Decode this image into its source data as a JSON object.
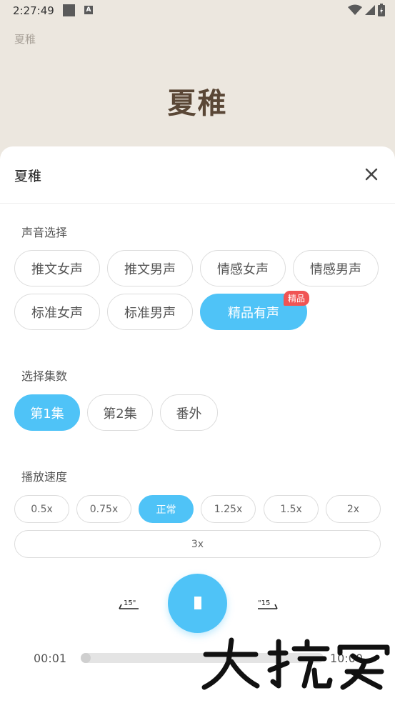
{
  "status_bar": {
    "time": "2:27:49"
  },
  "background": {
    "small_title": "夏稚",
    "big_title": "夏稚"
  },
  "sheet": {
    "title": "夏稚",
    "voice_section": {
      "label": "声音选择",
      "options": [
        "推文女声",
        "推文男声",
        "情感女声",
        "情感男声",
        "标准女声",
        "标准男声",
        "精品有声"
      ],
      "selected": "精品有声",
      "badge": "精品"
    },
    "episode_section": {
      "label": "选择集数",
      "options": [
        "第1集",
        "第2集",
        "番外"
      ],
      "selected": "第1集"
    },
    "speed_section": {
      "label": "播放速度",
      "options": [
        "0.5x",
        "0.75x",
        "正常",
        "1.25x",
        "1.5x",
        "2x",
        "3x"
      ],
      "selected": "正常"
    },
    "player": {
      "rewind_label": "15\"",
      "forward_label": "\"15",
      "current_time": "00:01",
      "total_time": "10:00",
      "progress_fraction": 0.003
    }
  },
  "colors": {
    "accent": "#4fc3f7",
    "badge": "#f05454",
    "background": "#ece7df"
  }
}
